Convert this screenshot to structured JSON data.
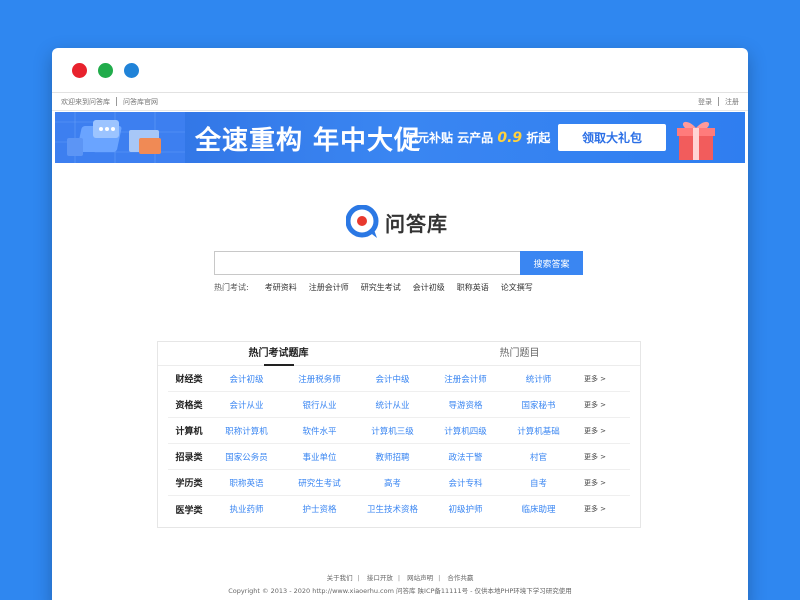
{
  "window": {
    "dots": [
      {
        "name": "close",
        "color": "#e8222d"
      },
      {
        "name": "minimize",
        "color": "#21ac4b"
      },
      {
        "name": "maximize",
        "color": "#2083d8"
      }
    ]
  },
  "topbar": {
    "welcome": "欢迎来到问答库",
    "official": "问答库官网",
    "login": "登录",
    "register": "注册"
  },
  "banner": {
    "title": "全速重构 年中大促",
    "sub_prefix": "亿元补贴 云产品",
    "sub_highlight": "0.9",
    "sub_suffix": "折起",
    "button": "领取大礼包"
  },
  "logo": {
    "text": "问答库",
    "accent": "#2b78e4",
    "dot": "#e8392f"
  },
  "search": {
    "value": "",
    "placeholder": "",
    "button": "搜索答案"
  },
  "hot": {
    "label": "热门考试:",
    "tags": [
      "考研资料",
      "注册会计师",
      "研究生考试",
      "会计初级",
      "职称英语",
      "论文撰写"
    ]
  },
  "panel": {
    "tabs": [
      "热门考试题库",
      "热门题目"
    ],
    "more": "更多 >",
    "rows": [
      {
        "category": "财经类",
        "items": [
          "会计初级",
          "注册税务师",
          "会计中级",
          "注册会计师",
          "统计师"
        ]
      },
      {
        "category": "资格类",
        "items": [
          "会计从业",
          "银行从业",
          "统计从业",
          "导游资格",
          "国家秘书"
        ]
      },
      {
        "category": "计算机",
        "items": [
          "职称计算机",
          "软件水平",
          "计算机三级",
          "计算机四级",
          "计算机基础"
        ]
      },
      {
        "category": "招录类",
        "items": [
          "国家公务员",
          "事业单位",
          "教师招聘",
          "政法干警",
          "村官"
        ]
      },
      {
        "category": "学历类",
        "items": [
          "职称英语",
          "研究生考试",
          "高考",
          "会计专科",
          "自考"
        ]
      },
      {
        "category": "医学类",
        "items": [
          "执业药师",
          "护士资格",
          "卫生技术资格",
          "初级护师",
          "临床助理"
        ]
      }
    ]
  },
  "footer": {
    "links": [
      "关于我们",
      "接口开放",
      "网站声明",
      "合作共赢"
    ],
    "copyright": "Copyright © 2013 - 2020 http://www.xiaoerhu.com  问答库   陕ICP备11111号 - 仅供本地PHP环境下学习研究使用"
  }
}
